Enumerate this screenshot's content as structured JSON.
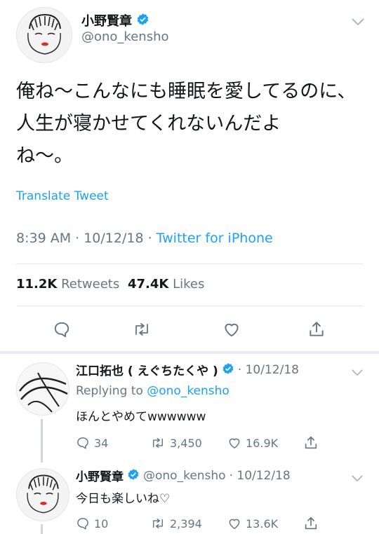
{
  "main_tweet": {
    "author_name": "小野賢章",
    "author_handle": "@ono_kensho",
    "text_lines": [
      "俺ね～こんなにも睡眠を愛してるのに、",
      "人生が寝かせてくれないんだよ",
      "ね～。"
    ],
    "translate_label": "Translate Tweet",
    "time": "8:39 AM · 10/12/18 · ",
    "source": "Twitter for iPhone",
    "retweets_count": "11.2K",
    "retweets_label": "Retweets",
    "likes_count": "47.4K",
    "likes_label": "Likes"
  },
  "replies": [
    {
      "author_name": "江口拓也 ( えぐちたくや )",
      "date": "· 10/12/18",
      "replying_to_label": "Replying to",
      "replying_to_handle": "@ono_kensho",
      "text": "ほんとやめてwwwwww",
      "reply_count": "34",
      "retweet_count": "3,450",
      "like_count": "16.9K"
    },
    {
      "author_name": "小野賢章",
      "author_handle": "@ono_kensho",
      "date": "· 10/12/18",
      "text": "今日も楽しいね♡",
      "reply_count": "10",
      "retweet_count": "2,394",
      "like_count": "13.6K"
    }
  ],
  "colors": {
    "brand_blue": "#1da1f2",
    "secondary_text": "#657786",
    "divider": "#e1e8ed",
    "icon_gray": "#657786"
  },
  "icons": [
    "verified-icon",
    "chevron-down-icon",
    "reply-icon",
    "retweet-icon",
    "like-icon",
    "share-icon"
  ]
}
